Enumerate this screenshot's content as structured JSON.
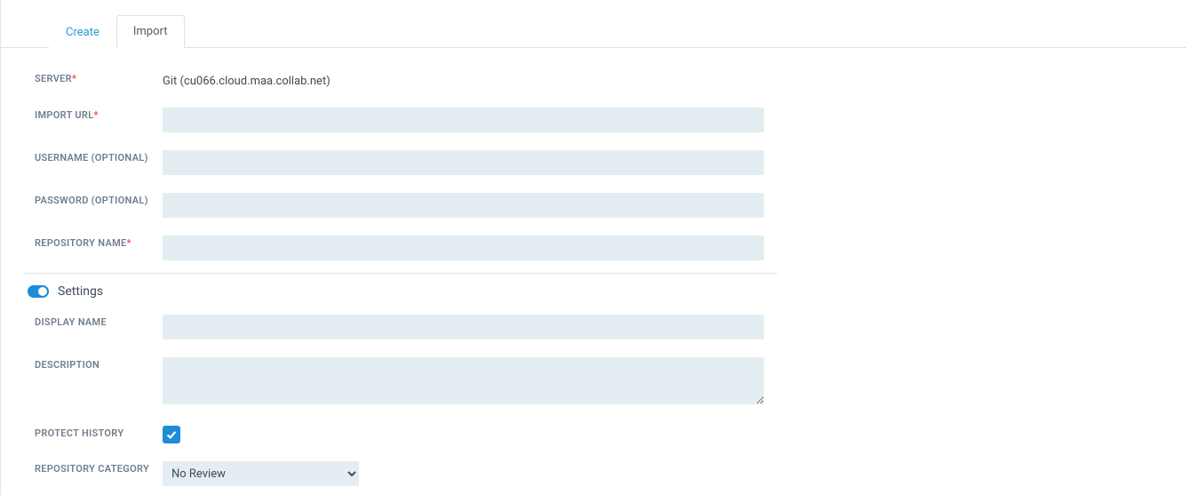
{
  "tabs": {
    "create": "Create",
    "import": "Import"
  },
  "labels": {
    "server": "SERVER",
    "import_url": "IMPORT URL",
    "username": "USERNAME (OPTIONAL)",
    "password": "PASSWORD (OPTIONAL)",
    "repo_name": "REPOSITORY NAME",
    "display_name": "DISPLAY NAME",
    "description": "DESCRIPTION",
    "protect_history": "PROTECT HISTORY",
    "repo_category": "REPOSITORY CATEGORY"
  },
  "required_marker": "*",
  "server_value": "Git (cu066.cloud.maa.collab.net)",
  "settings_label": "Settings",
  "repo_category_value": "No Review",
  "fields": {
    "import_url": "",
    "username": "",
    "password": "",
    "repo_name": "",
    "display_name": "",
    "description": ""
  },
  "protect_history_checked": true,
  "settings_on": true
}
